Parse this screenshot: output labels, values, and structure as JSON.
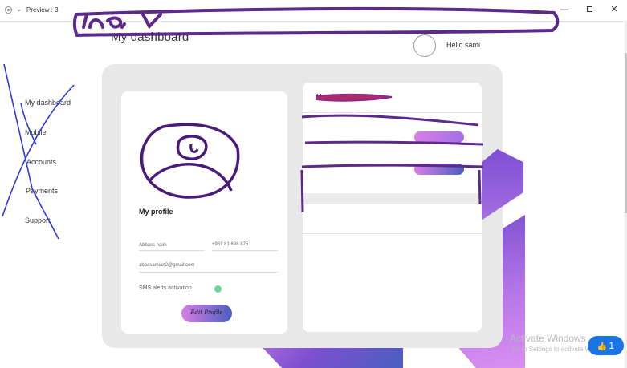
{
  "window": {
    "title": "Preview : 3",
    "minimize": "—",
    "close": "✕"
  },
  "header": {
    "title": "My dashboard",
    "greeting": "Hello sami"
  },
  "sidebar": {
    "items": [
      {
        "label": "My dashboard"
      },
      {
        "label": "Mobile"
      },
      {
        "label": "Accounts"
      },
      {
        "label": "Payments"
      },
      {
        "label": "Support"
      }
    ]
  },
  "profile": {
    "title": "My profile",
    "name": "Abbass naim",
    "phone": "+961 81 698 875",
    "email": "abbasamian2@gmail.com",
    "sms_label": "SMS alerts activation",
    "edit_button": "Edit Profile"
  },
  "right_panel": {
    "title": "My services"
  },
  "overlay": {
    "watermark": "Activate Windows",
    "watermark_sub": "Go to Settings to activate Windows.",
    "like_count": "1"
  },
  "colors": {
    "accent_pink": "#d77fe6",
    "accent_blue": "#4a5fc0",
    "scribble": "#5b2a8a",
    "sms_on": "#6fd69a"
  }
}
